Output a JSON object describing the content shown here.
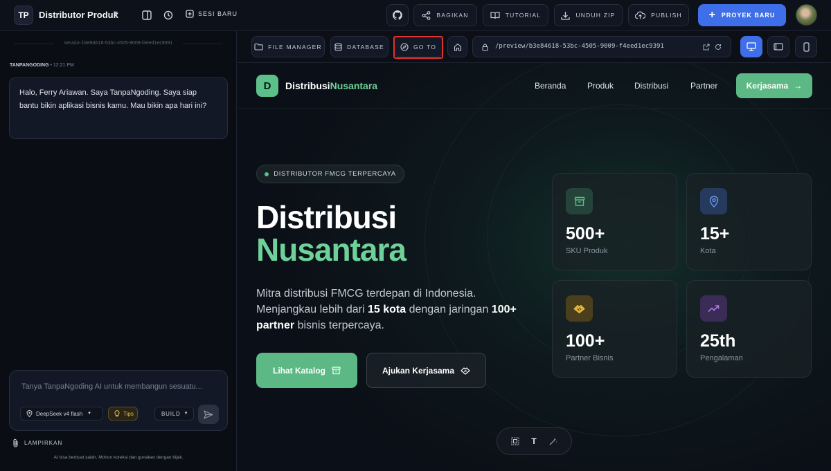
{
  "topbar": {
    "logo_text": "TP",
    "project_title": "Distributor Produk",
    "new_session_label": "SESI BARU",
    "share_label": "BAGIKAN",
    "tutorial_label": "TUTORIAL",
    "download_label": "UNDUH ZIP",
    "publish_label": "PUBLISH",
    "new_project_label": "PROYEK BARU"
  },
  "chat": {
    "session_id": "session b3e84618-53bc-4505-9009-f4eed1ec9391",
    "sender": "TANPANGODING",
    "time": "• 12:21 PM",
    "message": "Halo, Ferry Ariawan. Saya TanpaNgoding. Saya siap bantu bikin aplikasi bisnis kamu. Mau bikin apa hari ini?",
    "input_placeholder": "Tanya TanpaNgoding AI untuk membangun sesuatu...",
    "model": "DeepSeek v4 flash",
    "tips": "Tips",
    "mode": "BUILD",
    "attach_label": "LAMPIRKAN",
    "disclaimer": "AI bisa berbuat salah. Mohon koreksi dan gunakan dengan bijak."
  },
  "preview_toolbar": {
    "file_manager": "FILE MANAGER",
    "database": "DATABASE",
    "goto": "GO TO",
    "url": "/preview/b3e84618-53bc-4505-9009-f4eed1ec9391"
  },
  "site": {
    "brand_letter": "D",
    "brand_a": "Distribusi",
    "brand_b": "Nusantara",
    "nav": [
      "Beranda",
      "Produk",
      "Distribusi",
      "Partner"
    ],
    "nav_cta": "Kerjasama",
    "badge": "DISTRIBUTOR FMCG TERPERCAYA",
    "headline_1": "Distribusi",
    "headline_2": "Nusantara",
    "desc_1": "Mitra distribusi FMCG terdepan di Indonesia. Menjangkau lebih dari ",
    "desc_b1": "15 kota",
    "desc_2": " dengan jaringan ",
    "desc_b2": "100+ partner",
    "desc_3": " bisnis terpercaya.",
    "btn_catalog": "Lihat Katalog",
    "btn_partner": "Ajukan Kerjasama",
    "stats": [
      {
        "value": "500+",
        "label": "SKU Produk",
        "icon": "archive-icon",
        "color": "#5cc08a"
      },
      {
        "value": "15+",
        "label": "Kota",
        "icon": "map-pin-icon",
        "color": "#6a9cf0"
      },
      {
        "value": "100+",
        "label": "Partner Bisnis",
        "icon": "handshake-icon",
        "color": "#e0b33c"
      },
      {
        "value": "25th",
        "label": "Pengalaman",
        "icon": "trending-up-icon",
        "color": "#a87ae8"
      }
    ]
  },
  "floatbar": {
    "text_tool": "T"
  }
}
